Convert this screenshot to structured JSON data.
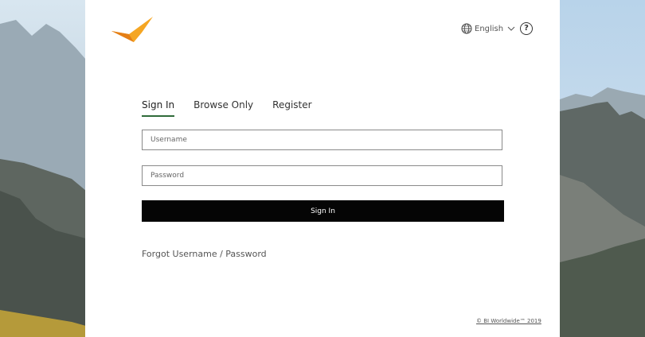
{
  "header": {
    "language_label": "English",
    "help_symbol": "?"
  },
  "tabs": [
    {
      "label": "Sign In",
      "active": true
    },
    {
      "label": "Browse Only",
      "active": false
    },
    {
      "label": "Register",
      "active": false
    }
  ],
  "form": {
    "username_placeholder": "Username",
    "username_value": "",
    "password_placeholder": "Password",
    "password_value": "",
    "submit_label": "Sign In"
  },
  "links": {
    "forgot": "Forgot Username / Password",
    "copyright": "© BI Worldwide™ 2019"
  },
  "colors": {
    "accent_green": "#2f6b3a",
    "button_black": "#050505",
    "logo_orange": "#f5a623"
  },
  "icons": {
    "logo": "bird-logo-icon",
    "language": "globe-icon",
    "dropdown": "chevron-down-icon",
    "help": "help-icon"
  }
}
